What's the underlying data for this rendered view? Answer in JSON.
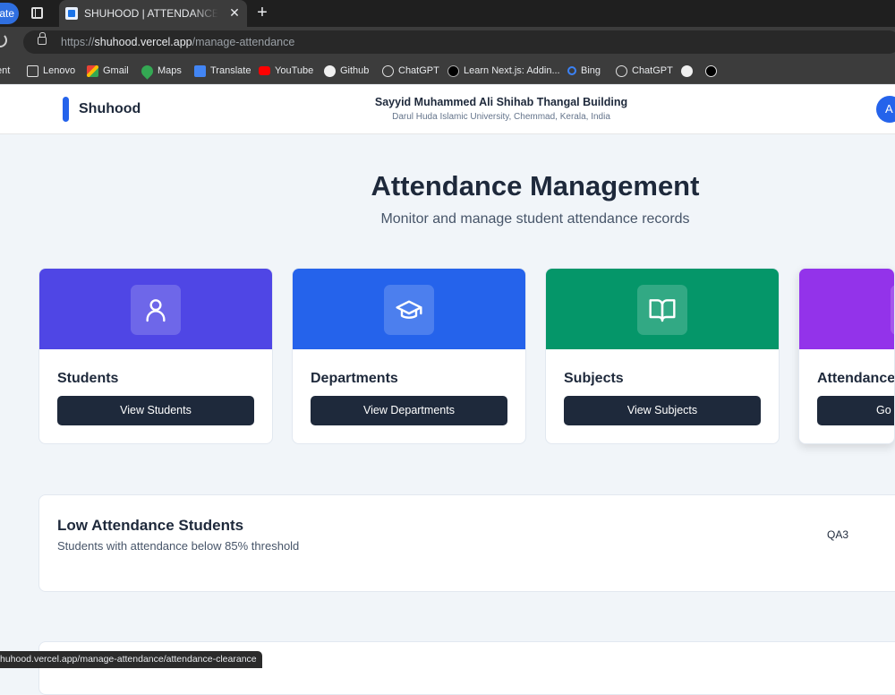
{
  "browser": {
    "update_label": "ate",
    "tab_title": "SHUHOOD | ATTENDANCE APPLICATION",
    "tab_close": "✕",
    "new_tab": "+",
    "url_scheme": "https://",
    "url_host": "shuhood.vercel.app",
    "url_path": "/manage-attendance",
    "bookmarks": [
      {
        "label": "ent",
        "icon": "folder-icon"
      },
      {
        "label": "Lenovo",
        "icon": "folder-icon"
      },
      {
        "label": "Gmail",
        "icon": "gmail-icon"
      },
      {
        "label": "Maps",
        "icon": "maps-icon"
      },
      {
        "label": "Translate",
        "icon": "translate-icon"
      },
      {
        "label": "YouTube",
        "icon": "youtube-icon"
      },
      {
        "label": "Github",
        "icon": "github-icon"
      },
      {
        "label": "ChatGPT",
        "icon": "chatgpt-icon"
      },
      {
        "label": "Learn Next.js: Addin...",
        "icon": "nextjs-icon"
      },
      {
        "label": "Bing",
        "icon": "bing-icon"
      },
      {
        "label": "ChatGPT",
        "icon": "chatgpt-icon"
      },
      {
        "label": "",
        "icon": "github-icon"
      },
      {
        "label": "",
        "icon": "vercel-icon"
      }
    ],
    "status_url": "huhood.vercel.app/manage-attendance/attendance-clearance"
  },
  "header": {
    "logo": "Shuhood",
    "building": "Sayyid Muhammed Ali Shihab Thangal Building",
    "university": "Darul Huda Islamic University, Chemmad, Kerala, India",
    "avatar_initial": "A"
  },
  "main": {
    "title": "Attendance Management",
    "subtitle": "Monitor and manage student attendance records",
    "cards": [
      {
        "title": "Students",
        "button": "View Students",
        "icon": "user-icon",
        "color": "#4f46e5"
      },
      {
        "title": "Departments",
        "button": "View Departments",
        "icon": "graduation-cap-icon",
        "color": "#2563eb"
      },
      {
        "title": "Subjects",
        "button": "View Subjects",
        "icon": "book-open-icon",
        "color": "#059669"
      },
      {
        "title": "Attendance C",
        "button": "Go T",
        "icon": "clipboard-icon",
        "color": "#9333ea"
      }
    ],
    "low_attendance": {
      "title": "Low Attendance Students",
      "subtitle": "Students with attendance below 85% threshold",
      "tag": "QA3"
    }
  }
}
